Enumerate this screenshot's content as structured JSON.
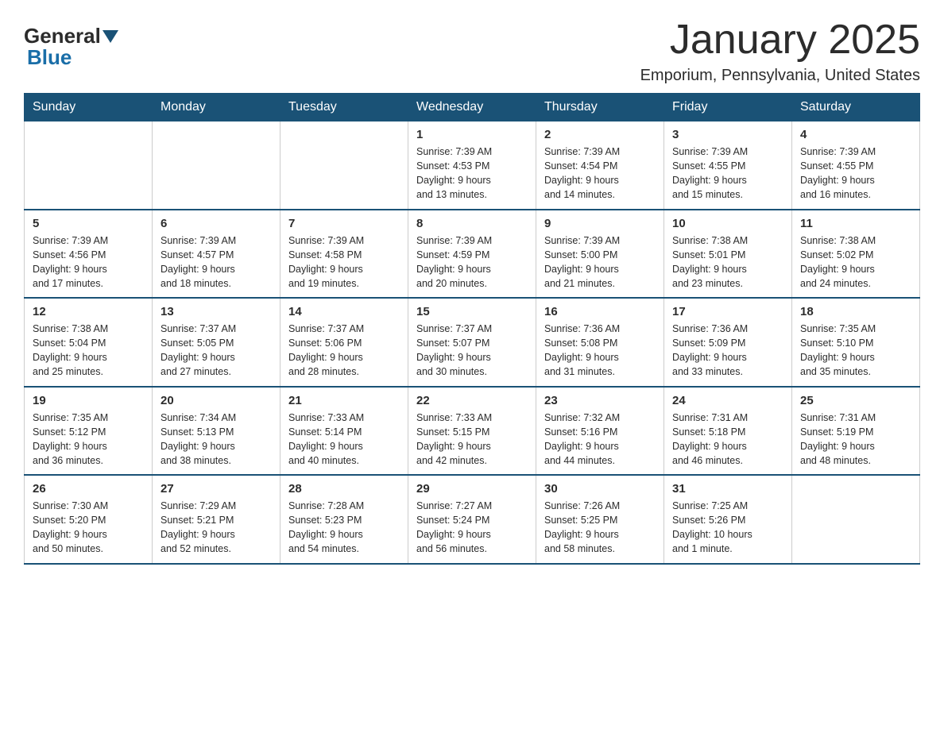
{
  "logo": {
    "general": "General",
    "blue": "Blue"
  },
  "title": "January 2025",
  "subtitle": "Emporium, Pennsylvania, United States",
  "days_of_week": [
    "Sunday",
    "Monday",
    "Tuesday",
    "Wednesday",
    "Thursday",
    "Friday",
    "Saturday"
  ],
  "weeks": [
    [
      {
        "day": "",
        "info": ""
      },
      {
        "day": "",
        "info": ""
      },
      {
        "day": "",
        "info": ""
      },
      {
        "day": "1",
        "info": "Sunrise: 7:39 AM\nSunset: 4:53 PM\nDaylight: 9 hours\nand 13 minutes."
      },
      {
        "day": "2",
        "info": "Sunrise: 7:39 AM\nSunset: 4:54 PM\nDaylight: 9 hours\nand 14 minutes."
      },
      {
        "day": "3",
        "info": "Sunrise: 7:39 AM\nSunset: 4:55 PM\nDaylight: 9 hours\nand 15 minutes."
      },
      {
        "day": "4",
        "info": "Sunrise: 7:39 AM\nSunset: 4:55 PM\nDaylight: 9 hours\nand 16 minutes."
      }
    ],
    [
      {
        "day": "5",
        "info": "Sunrise: 7:39 AM\nSunset: 4:56 PM\nDaylight: 9 hours\nand 17 minutes."
      },
      {
        "day": "6",
        "info": "Sunrise: 7:39 AM\nSunset: 4:57 PM\nDaylight: 9 hours\nand 18 minutes."
      },
      {
        "day": "7",
        "info": "Sunrise: 7:39 AM\nSunset: 4:58 PM\nDaylight: 9 hours\nand 19 minutes."
      },
      {
        "day": "8",
        "info": "Sunrise: 7:39 AM\nSunset: 4:59 PM\nDaylight: 9 hours\nand 20 minutes."
      },
      {
        "day": "9",
        "info": "Sunrise: 7:39 AM\nSunset: 5:00 PM\nDaylight: 9 hours\nand 21 minutes."
      },
      {
        "day": "10",
        "info": "Sunrise: 7:38 AM\nSunset: 5:01 PM\nDaylight: 9 hours\nand 23 minutes."
      },
      {
        "day": "11",
        "info": "Sunrise: 7:38 AM\nSunset: 5:02 PM\nDaylight: 9 hours\nand 24 minutes."
      }
    ],
    [
      {
        "day": "12",
        "info": "Sunrise: 7:38 AM\nSunset: 5:04 PM\nDaylight: 9 hours\nand 25 minutes."
      },
      {
        "day": "13",
        "info": "Sunrise: 7:37 AM\nSunset: 5:05 PM\nDaylight: 9 hours\nand 27 minutes."
      },
      {
        "day": "14",
        "info": "Sunrise: 7:37 AM\nSunset: 5:06 PM\nDaylight: 9 hours\nand 28 minutes."
      },
      {
        "day": "15",
        "info": "Sunrise: 7:37 AM\nSunset: 5:07 PM\nDaylight: 9 hours\nand 30 minutes."
      },
      {
        "day": "16",
        "info": "Sunrise: 7:36 AM\nSunset: 5:08 PM\nDaylight: 9 hours\nand 31 minutes."
      },
      {
        "day": "17",
        "info": "Sunrise: 7:36 AM\nSunset: 5:09 PM\nDaylight: 9 hours\nand 33 minutes."
      },
      {
        "day": "18",
        "info": "Sunrise: 7:35 AM\nSunset: 5:10 PM\nDaylight: 9 hours\nand 35 minutes."
      }
    ],
    [
      {
        "day": "19",
        "info": "Sunrise: 7:35 AM\nSunset: 5:12 PM\nDaylight: 9 hours\nand 36 minutes."
      },
      {
        "day": "20",
        "info": "Sunrise: 7:34 AM\nSunset: 5:13 PM\nDaylight: 9 hours\nand 38 minutes."
      },
      {
        "day": "21",
        "info": "Sunrise: 7:33 AM\nSunset: 5:14 PM\nDaylight: 9 hours\nand 40 minutes."
      },
      {
        "day": "22",
        "info": "Sunrise: 7:33 AM\nSunset: 5:15 PM\nDaylight: 9 hours\nand 42 minutes."
      },
      {
        "day": "23",
        "info": "Sunrise: 7:32 AM\nSunset: 5:16 PM\nDaylight: 9 hours\nand 44 minutes."
      },
      {
        "day": "24",
        "info": "Sunrise: 7:31 AM\nSunset: 5:18 PM\nDaylight: 9 hours\nand 46 minutes."
      },
      {
        "day": "25",
        "info": "Sunrise: 7:31 AM\nSunset: 5:19 PM\nDaylight: 9 hours\nand 48 minutes."
      }
    ],
    [
      {
        "day": "26",
        "info": "Sunrise: 7:30 AM\nSunset: 5:20 PM\nDaylight: 9 hours\nand 50 minutes."
      },
      {
        "day": "27",
        "info": "Sunrise: 7:29 AM\nSunset: 5:21 PM\nDaylight: 9 hours\nand 52 minutes."
      },
      {
        "day": "28",
        "info": "Sunrise: 7:28 AM\nSunset: 5:23 PM\nDaylight: 9 hours\nand 54 minutes."
      },
      {
        "day": "29",
        "info": "Sunrise: 7:27 AM\nSunset: 5:24 PM\nDaylight: 9 hours\nand 56 minutes."
      },
      {
        "day": "30",
        "info": "Sunrise: 7:26 AM\nSunset: 5:25 PM\nDaylight: 9 hours\nand 58 minutes."
      },
      {
        "day": "31",
        "info": "Sunrise: 7:25 AM\nSunset: 5:26 PM\nDaylight: 10 hours\nand 1 minute."
      },
      {
        "day": "",
        "info": ""
      }
    ]
  ]
}
